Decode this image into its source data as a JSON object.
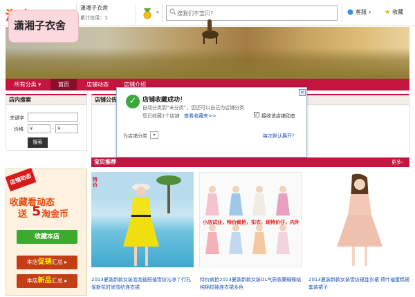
{
  "header": {
    "logo": "淘宝",
    "logo_sub": "店铺",
    "shop_name": "潇湘子衣舍",
    "credit": "累计信用：1",
    "search_placeholder": "搜我们不宝贝?",
    "service": "客服",
    "favorite": "收藏"
  },
  "banner": {
    "shop_title": "潇湘子衣舍"
  },
  "nav": {
    "all": "所有分类",
    "home": "首页",
    "news": "店铺动态",
    "intro": "店铺介绍"
  },
  "shop_search": {
    "title": "店内搜索",
    "keyword_label": "关键字",
    "price_label": "价格",
    "price_min": "¥",
    "price_sep": "-",
    "price_max": "¥",
    "button": "搜索"
  },
  "promo": {
    "tag": "店铺动态",
    "line1": "收藏看动态",
    "line2_prefix": "送",
    "line2_num": "5",
    "line2_suffix": "淘金币",
    "collect_button": "收藏本店",
    "btn1_prefix": "本店",
    "btn1_em": "促销",
    "btn1_suffix": "汇总 ▸",
    "btn2_prefix": "本店",
    "btn2_em": "新品",
    "btn2_suffix": "汇总 ▸"
  },
  "announcement": {
    "title": "店铺公告"
  },
  "recommend": {
    "title": "宝贝推荐",
    "more": "更多›",
    "products": [
      {
        "caption": "2013夏装新款女装泡泡袖短袖雪纺沁凉丫行孔雀新花时尚雪纺连衣裙"
      },
      {
        "caption": "特价疯抢2013夏装新款女装OL气质收腰蝴蝶结纯棉短袖连衣裙多色",
        "banner_text": "小店试业，特价疯抢，扣衣，现特价仔，内外"
      },
      {
        "caption": "2013夏装新款女装雪纺裙连衣裙 荷叶袖蛋糕裙套装裙子"
      }
    ]
  },
  "popup": {
    "title": "店铺收藏成功！",
    "line1": "自动分类到“未分类”，您还可以自己为店铺分类",
    "line2": "您已收藏1个店铺",
    "link": "查看收藏夹>>",
    "checkbox_label": "接收该店铺动态",
    "category_label": "为店铺分类",
    "why": "每次默认展开？",
    "close": "×"
  },
  "colors": {
    "nav": "#c5153f",
    "logo": "#ff4400",
    "green": "#3cab2d"
  }
}
